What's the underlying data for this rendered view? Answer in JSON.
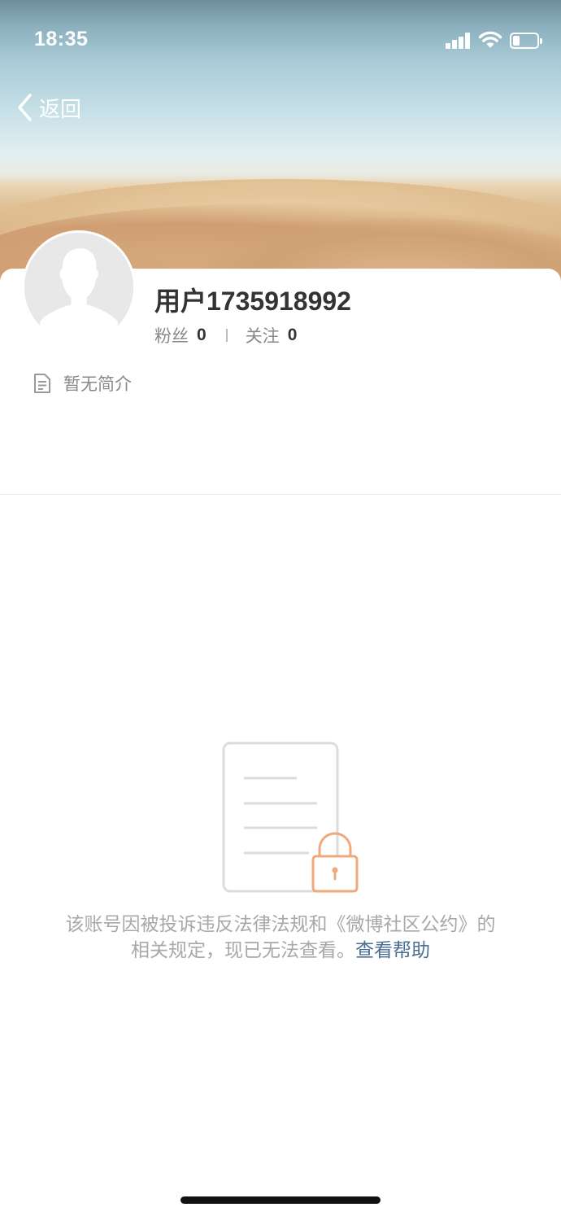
{
  "status_bar": {
    "time": "18:35",
    "battery_level": 0.3
  },
  "nav": {
    "back_label": "返回"
  },
  "profile": {
    "username": "用户1735918992",
    "followers_label": "粉丝",
    "followers_count": "0",
    "following_label": "关注",
    "following_count": "0",
    "bio": "暂无简介"
  },
  "notice": {
    "message": "该账号因被投诉违反法律法规和《微博社区公约》的相关规定，现已无法查看。",
    "help_link": "查看帮助"
  },
  "colors": {
    "link": "#4a6d93",
    "lock": "#f0a97a",
    "muted_text": "#a8a8a8"
  },
  "icons": [
    "back-chevron-icon",
    "signal-icon",
    "wifi-icon",
    "battery-icon",
    "document-icon",
    "locked-document-icon",
    "default-avatar-icon"
  ]
}
